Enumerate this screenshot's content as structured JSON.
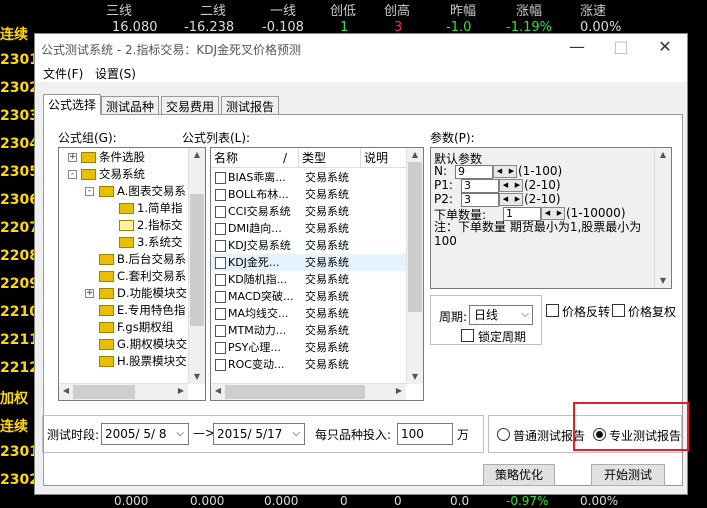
{
  "background": {
    "header": [
      "三线",
      "二线",
      "一线",
      "创低",
      "创高",
      "昨幅",
      "涨幅",
      "涨速"
    ],
    "row1": [
      "16.080",
      "-16.238",
      "-0.108",
      "1",
      "3",
      "-1.0",
      "-1.19%",
      "0.00%"
    ],
    "left_codes": [
      "连续",
      "2301",
      "2302",
      "2303",
      "2304",
      "2305",
      "2306",
      "2207",
      "2208",
      "2209",
      "2210",
      "2211",
      "2212",
      "加权",
      "连续",
      "2301",
      "2302"
    ],
    "bottom_row": [
      "0.000",
      "0.000",
      "0.000",
      "0",
      "0",
      "0.0",
      "-0.97%",
      "0.00%"
    ]
  },
  "window": {
    "title": "公式测试系统 - 2.指标交易：KDJ金死叉价格预测",
    "minimize": "—",
    "maximize": "□",
    "close": "✕"
  },
  "menu": [
    "文件(F)",
    "设置(S)"
  ],
  "tabs": [
    "公式选择",
    "测试品种",
    "交易费用",
    "测试报告"
  ],
  "labels": {
    "formula_group": "公式组(G):",
    "formula_list": "公式列表(L):",
    "params": "参数(P):",
    "period": "周期:",
    "lock_period": "锁定周期",
    "price_reverse": "价格反转",
    "price_rehab": "价格复权",
    "test_period": "测试时段:",
    "arrow": "—>",
    "per_invest": "每只品种投入:",
    "unit": "万",
    "normal_report": "普通测试报告",
    "pro_report": "专业测试报告"
  },
  "tree": [
    {
      "label": "条件选股",
      "level": 0,
      "expander": "+"
    },
    {
      "label": "交易系统",
      "level": 0,
      "expander": "-"
    },
    {
      "label": "A.图表交易系",
      "level": 1,
      "expander": "-"
    },
    {
      "label": "1.简单指",
      "level": 2,
      "expander": ""
    },
    {
      "label": "2.指标交",
      "level": 2,
      "expander": ""
    },
    {
      "label": "3.系统交",
      "level": 2,
      "expander": ""
    },
    {
      "label": "B.后台交易系",
      "level": 1,
      "expander": ""
    },
    {
      "label": "C.套利交易系",
      "level": 1,
      "expander": ""
    },
    {
      "label": "D.功能模块交",
      "level": 1,
      "expander": "+"
    },
    {
      "label": "E.专用特色指",
      "level": 1,
      "expander": ""
    },
    {
      "label": "F.gs期权组",
      "level": 1,
      "expander": ""
    },
    {
      "label": "G.期权模块交",
      "level": 1,
      "expander": ""
    },
    {
      "label": "H.股票模块交",
      "level": 1,
      "expander": ""
    }
  ],
  "formula_columns": [
    "名称",
    "/",
    "类型",
    "说明"
  ],
  "formulas": [
    {
      "name": "BIAS乖离...",
      "type": "交易系统"
    },
    {
      "name": "BOLL布林...",
      "type": "交易系统"
    },
    {
      "name": "CCI交易系统",
      "type": "交易系统"
    },
    {
      "name": "DMI趋向...",
      "type": "交易系统"
    },
    {
      "name": "KDJ交易系统",
      "type": "交易系统"
    },
    {
      "name": "KDJ金死...",
      "type": "交易系统"
    },
    {
      "name": "KD随机指...",
      "type": "交易系统"
    },
    {
      "name": "MACD突破...",
      "type": "交易系统"
    },
    {
      "name": "MA均线交...",
      "type": "交易系统"
    },
    {
      "name": "MTM动力...",
      "type": "交易系统"
    },
    {
      "name": "PSY心理...",
      "type": "交易系统"
    },
    {
      "name": "ROC变动...",
      "type": "交易系统"
    }
  ],
  "params": {
    "heading": "默认参数",
    "n_label": "N:",
    "n_value": "9",
    "n_range": "(1-100)",
    "p1_label": "P1:",
    "p1_value": "3",
    "p1_range": "(2-10)",
    "p2_label": "P2:",
    "p2_value": "3",
    "p2_range": "(2-10)",
    "qty_label": "下单数量:",
    "qty_value": "1",
    "qty_range": "(1-10000)",
    "note": "注：下单数量 期货最小为1,股票最小为100"
  },
  "period_value": "日线",
  "start_date": "2005/ 5/ 8",
  "end_date": "2015/ 5/17",
  "invest_value": "100",
  "buttons": {
    "optimize": "策略优化",
    "start": "开始测试"
  }
}
